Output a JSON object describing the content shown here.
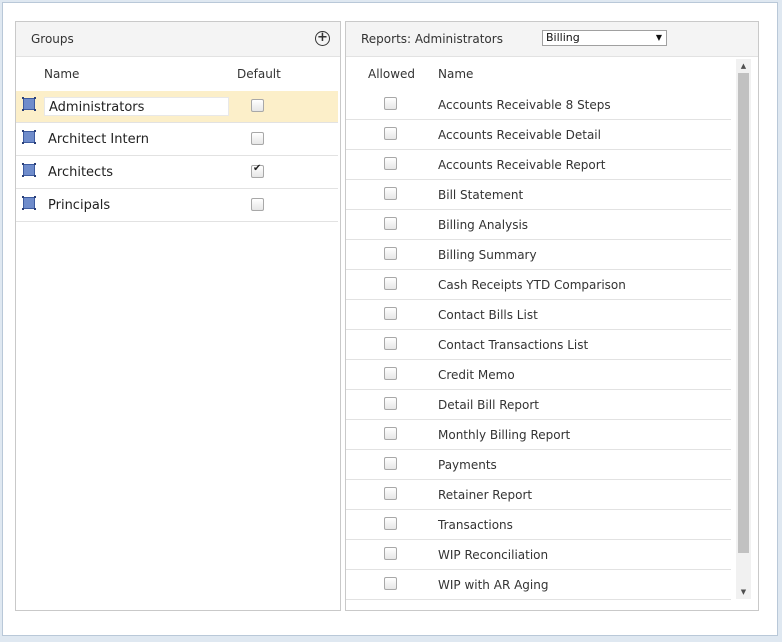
{
  "groups_panel": {
    "title": "Groups",
    "col_name": "Name",
    "col_default": "Default",
    "add_icon": "plus-circle-icon",
    "rows": [
      {
        "name": "Administrators",
        "default": false,
        "selected": true
      },
      {
        "name": "Architect Intern",
        "default": false,
        "selected": false
      },
      {
        "name": "Architects",
        "default": true,
        "selected": false
      },
      {
        "name": "Principals",
        "default": false,
        "selected": false
      }
    ]
  },
  "reports_panel": {
    "title": "Reports: Administrators",
    "category_select": "Billing",
    "col_allowed": "Allowed",
    "col_name": "Name",
    "rows": [
      {
        "name": "Accounts Receivable 8 Steps",
        "allowed": false
      },
      {
        "name": "Accounts Receivable Detail",
        "allowed": false
      },
      {
        "name": "Accounts Receivable Report",
        "allowed": false
      },
      {
        "name": "Bill Statement",
        "allowed": false
      },
      {
        "name": "Billing Analysis",
        "allowed": false
      },
      {
        "name": "Billing Summary",
        "allowed": false
      },
      {
        "name": "Cash Receipts YTD Comparison",
        "allowed": false
      },
      {
        "name": "Contact Bills List",
        "allowed": false
      },
      {
        "name": "Contact Transactions List",
        "allowed": false
      },
      {
        "name": "Credit Memo",
        "allowed": false
      },
      {
        "name": "Detail Bill Report",
        "allowed": false
      },
      {
        "name": "Monthly Billing Report",
        "allowed": false
      },
      {
        "name": "Payments",
        "allowed": false
      },
      {
        "name": "Retainer Report",
        "allowed": false
      },
      {
        "name": "Transactions",
        "allowed": false
      },
      {
        "name": "WIP Reconciliation",
        "allowed": false
      },
      {
        "name": "WIP with AR Aging",
        "allowed": false
      }
    ]
  },
  "colors": {
    "selected_row": "#fcefc9",
    "drag_handle": "#6f8ccb",
    "page_background": "#dfe8f1"
  }
}
